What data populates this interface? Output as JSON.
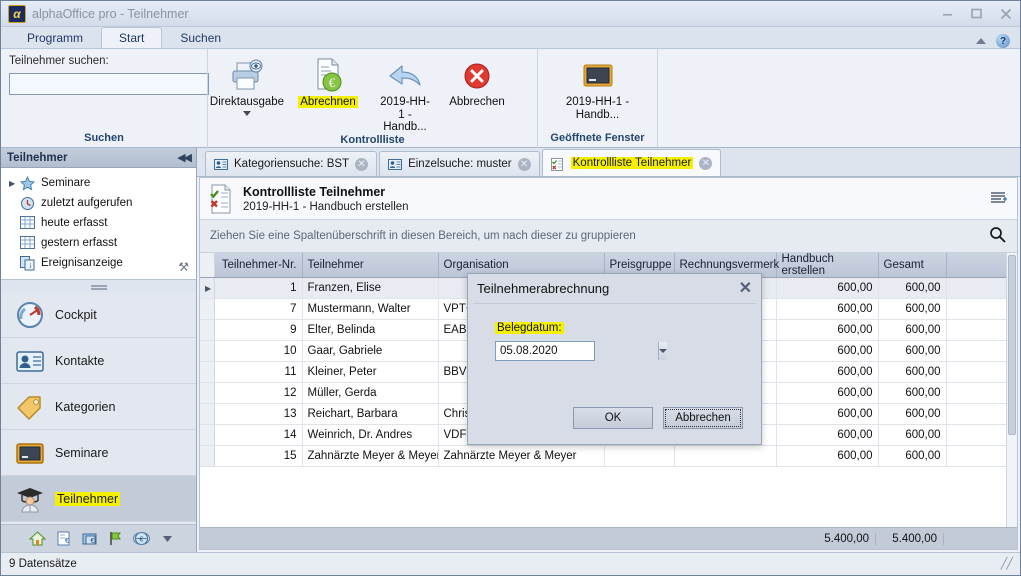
{
  "window": {
    "title": "alphaOffice pro - Teilnehmer",
    "logo_glyph": "α",
    "minimize": "—",
    "maximize": "❐",
    "close": "✕"
  },
  "ribbon_tabs": [
    {
      "label": "Programm",
      "active": false
    },
    {
      "label": "Start",
      "active": true
    },
    {
      "label": "Suchen",
      "active": false
    }
  ],
  "ribbon": {
    "search_group": {
      "label": "Teilnehmer suchen:",
      "value": "",
      "placeholder": "",
      "group_label": "Suchen"
    },
    "kontrollliste_group": {
      "group_label": "Kontrollliste",
      "buttons": [
        {
          "label": "Direktausgabe",
          "icon": "printer-preview-icon",
          "has_dropdown": true,
          "highlighted": false
        },
        {
          "label": "Abrechnen",
          "icon": "document-euro-icon",
          "has_dropdown": false,
          "highlighted": true
        },
        {
          "label": "2019-HH-1 - Handb...",
          "icon": "undo-arrow-icon",
          "has_dropdown": false,
          "highlighted": false
        },
        {
          "label": "Abbrechen",
          "icon": "cancel-red-icon",
          "has_dropdown": false,
          "highlighted": false
        }
      ]
    },
    "fenster_group": {
      "group_label": "Geöffnete Fenster",
      "buttons": [
        {
          "label": "2019-HH-1 - Handb...",
          "icon": "blackboard-icon",
          "has_dropdown": false,
          "highlighted": false
        }
      ]
    }
  },
  "sidebar": {
    "header": "Teilnehmer",
    "collapse_glyph": "◀◀",
    "tree": [
      {
        "label": "Seminare",
        "icon": "star-icon",
        "expandable": true
      },
      {
        "label": "zuletzt aufgerufen",
        "icon": "clock-icon",
        "expandable": false
      },
      {
        "label": "heute erfasst",
        "icon": "grid-icon",
        "expandable": false
      },
      {
        "label": "gestern erfasst",
        "icon": "grid-icon",
        "expandable": false
      },
      {
        "label": "Ereignisanzeige",
        "icon": "event-log-icon",
        "expandable": false
      }
    ],
    "nav": [
      {
        "label": "Cockpit",
        "icon": "gauge-icon",
        "selected": false
      },
      {
        "label": "Kontakte",
        "icon": "contact-card-icon",
        "selected": false
      },
      {
        "label": "Kategorien",
        "icon": "tag-icon",
        "selected": false
      },
      {
        "label": "Seminare",
        "icon": "blackboard-icon",
        "selected": false
      },
      {
        "label": "Teilnehmer",
        "icon": "graduate-icon",
        "selected": true,
        "highlighted": true
      }
    ],
    "mini_icons": [
      "home-icon",
      "invoice-icon",
      "folder-euro-icon",
      "flag-icon",
      "globe-euro-icon",
      "chevron-down-icon"
    ]
  },
  "doc_tabs": [
    {
      "label": "Kategoriensuche: BST",
      "icon": "card-icon",
      "active": false,
      "highlighted": false
    },
    {
      "label": "Einzelsuche: muster",
      "icon": "card-icon",
      "active": false,
      "highlighted": false
    },
    {
      "label": "Kontrollliste Teilnehmer",
      "icon": "checklist-icon",
      "active": true,
      "highlighted": true
    }
  ],
  "document": {
    "title": "Kontrollliste Teilnehmer",
    "subtitle": "2019-HH-1 - Handbuch erstellen",
    "group_hint": "Ziehen Sie eine Spaltenüberschrift in diesen Bereich, um nach dieser zu gruppieren",
    "columns": [
      {
        "label": "Teilnehmer-Nr.",
        "align": "right"
      },
      {
        "label": "Teilnehmer",
        "align": "left"
      },
      {
        "label": "Organisation",
        "align": "left"
      },
      {
        "label": "Preisgruppe",
        "align": "left"
      },
      {
        "label": "Rechnungsvermerk",
        "align": "left"
      },
      {
        "label": "Handbuch erstellen",
        "align": "right"
      },
      {
        "label": "Gesamt",
        "align": "right"
      }
    ],
    "rows": [
      {
        "nr": "1",
        "name": "Franzen, Elise",
        "org": "",
        "preisgruppe": "",
        "vermerk": "",
        "handbuch": "600,00",
        "gesamt": "600,00",
        "selected": true
      },
      {
        "nr": "7",
        "name": "Mustermann, Walter",
        "org": "VPT+H",
        "preisgruppe": "",
        "vermerk": "",
        "handbuch": "600,00",
        "gesamt": "600,00",
        "selected": false
      },
      {
        "nr": "9",
        "name": "Elter, Belinda",
        "org": "EABen",
        "preisgruppe": "",
        "vermerk": "",
        "handbuch": "600,00",
        "gesamt": "600,00",
        "selected": false
      },
      {
        "nr": "10",
        "name": "Gaar, Gabriele",
        "org": "",
        "preisgruppe": "",
        "vermerk": "",
        "handbuch": "600,00",
        "gesamt": "600,00",
        "selected": false
      },
      {
        "nr": "11",
        "name": "Kleiner, Peter",
        "org": "BBV",
        "preisgruppe": "",
        "vermerk": "",
        "handbuch": "600,00",
        "gesamt": "600,00",
        "selected": false
      },
      {
        "nr": "12",
        "name": "Müller, Gerda",
        "org": "",
        "preisgruppe": "",
        "vermerk": "",
        "handbuch": "600,00",
        "gesamt": "600,00",
        "selected": false
      },
      {
        "nr": "13",
        "name": "Reichart, Barbara",
        "org": "Christ",
        "preisgruppe": "",
        "vermerk": "",
        "handbuch": "600,00",
        "gesamt": "600,00",
        "selected": false
      },
      {
        "nr": "14",
        "name": "Weinrich, Dr. Andres",
        "org": "VDFI",
        "preisgruppe": "",
        "vermerk": "",
        "handbuch": "600,00",
        "gesamt": "600,00",
        "selected": false
      },
      {
        "nr": "15",
        "name": "Zahnärzte Meyer & Meyer",
        "org": "Zahnärzte Meyer & Meyer",
        "preisgruppe": "",
        "vermerk": "",
        "handbuch": "600,00",
        "gesamt": "600,00",
        "selected": false
      }
    ],
    "totals": {
      "handbuch": "5.400,00",
      "gesamt": "5.400,00"
    }
  },
  "dialog": {
    "title": "Teilnehmerabrechnung",
    "close_glyph": "✕",
    "field_label": "Belegdatum:",
    "field_value": "05.08.2020",
    "ok_label": "OK",
    "cancel_label": "Abbrechen"
  },
  "status": {
    "text": "9 Datensätze",
    "resize_glyph": "╱╱"
  },
  "colors": {
    "highlight": "#f5f000",
    "accent": "#1f3864",
    "selection": "#c3cbd9"
  }
}
